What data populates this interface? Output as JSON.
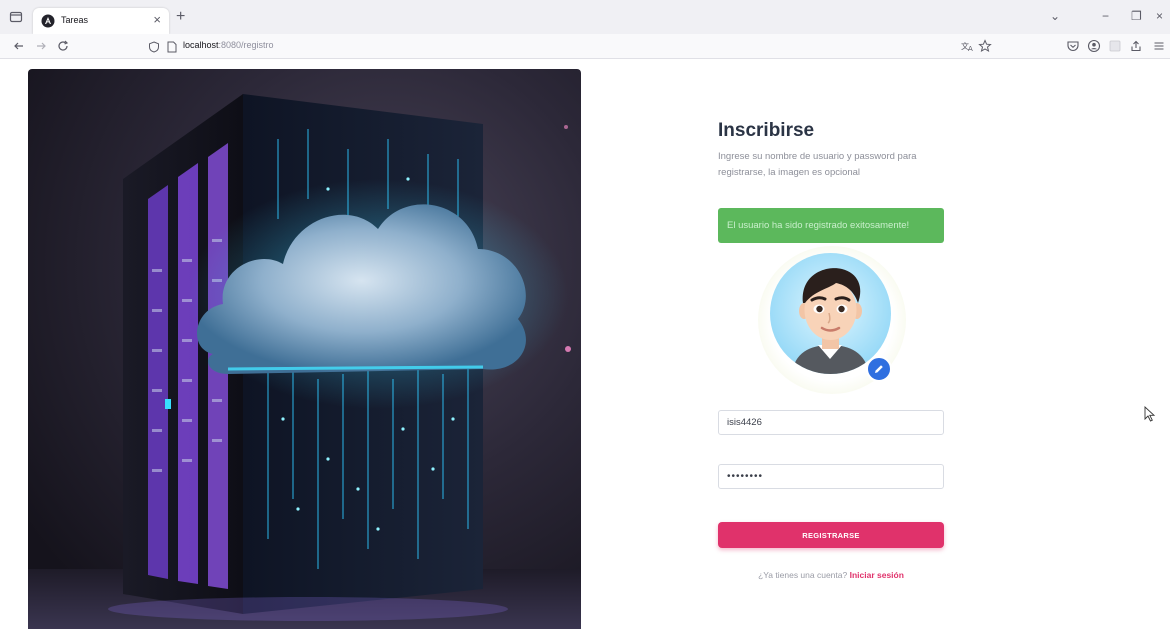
{
  "browser": {
    "tab_title": "Tareas",
    "tab_close": "×",
    "new_tab": "+",
    "url_host": "localhost",
    "url_path": ":8080/registro",
    "window_controls": {
      "menu": "⌄",
      "minimize": "−",
      "restore": "❐",
      "close": "×"
    }
  },
  "icons": {
    "tab_list": "tab-list-icon",
    "favicon": "angular-icon",
    "back": "arrow-left-icon",
    "forward": "arrow-right-icon",
    "reload": "reload-icon",
    "shield": "shield-icon",
    "page": "page-icon",
    "translate": "translate-icon",
    "bookmark": "star-icon",
    "pocket": "pocket-icon",
    "account": "account-icon",
    "extensions": "extensions-icon",
    "share": "share-icon",
    "menu": "hamburger-icon",
    "edit": "pencil-icon"
  },
  "form": {
    "title": "Inscribirse",
    "subtitle": "Ingrese su nombre de usuario y password para registrarse, la imagen es opcional",
    "alert": "El usuario ha sido registrado exitosamente!",
    "username_value": "isis4426",
    "password_value": "••••••••",
    "submit_label": "REGISTRARSE",
    "login_prompt": "¿Ya tienes una cuenta?",
    "login_link": "Iniciar sesión"
  },
  "colors": {
    "accent": "#e0326b",
    "alert_bg": "#5cb85c",
    "title": "#2b3445",
    "edit_badge": "#2f6fe0"
  }
}
